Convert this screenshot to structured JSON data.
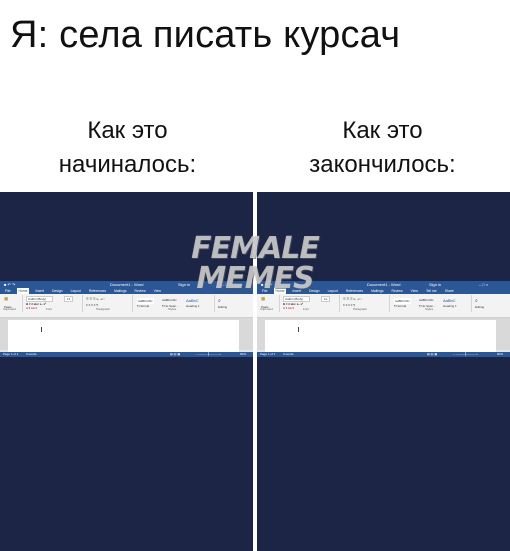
{
  "meme": {
    "title": "Я: села писать курсач",
    "captions": {
      "left": [
        "Как это",
        "начиналось:"
      ],
      "right": [
        "Как это",
        "закончилось:"
      ]
    },
    "watermark": [
      "FEMALE",
      "MEMES"
    ]
  },
  "word": {
    "doc_title": "Document1 - Word",
    "sign_in": "Sign in",
    "tabs": [
      "File",
      "Home",
      "Insert",
      "Design",
      "Layout",
      "References",
      "Mailings",
      "Review",
      "View"
    ],
    "tell_me": "Tell me",
    "share": "Share",
    "font_name": "Calibri (Body)",
    "font_size": "11",
    "groups": [
      "Clipboard",
      "Font",
      "Paragraph",
      "Styles",
      "Editing"
    ],
    "styles": [
      "AaBbCcDc",
      "AaBbCcDc",
      "AaBbC"
    ],
    "style_names": [
      "¶ Normal",
      "¶ No Spac...",
      "Heading 1"
    ],
    "paste": "Paste",
    "editing": "Editing",
    "status": {
      "page": "Page 1 of 1",
      "words": "0 words",
      "zoom": "90%"
    }
  },
  "colors": {
    "panel_bg": "#1d2546",
    "word_blue": "#2b5797"
  }
}
